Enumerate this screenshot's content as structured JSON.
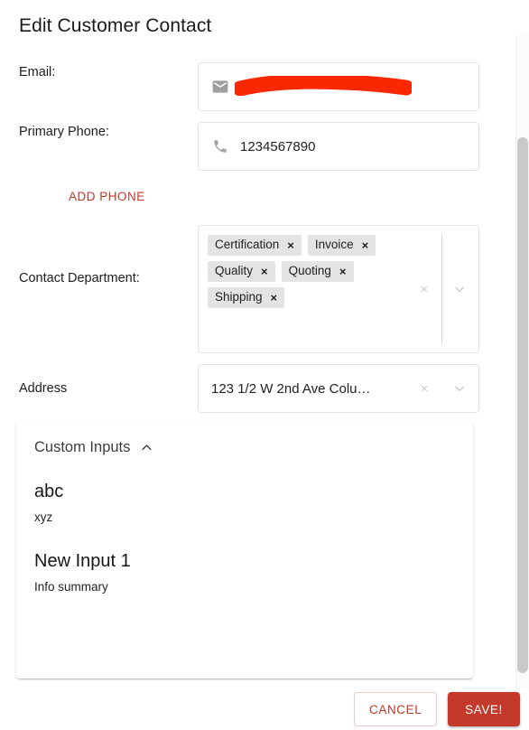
{
  "dialog": {
    "title": "Edit Customer Contact"
  },
  "fields": {
    "email": {
      "label": "Email:",
      "icon": "envelope-icon",
      "value": "",
      "redacted": true
    },
    "phone": {
      "label": "Primary Phone:",
      "icon": "phone-icon",
      "value": "1234567890"
    },
    "add_phone_label": "ADD PHONE",
    "contact_department": {
      "label": "Contact Department:",
      "chips": [
        {
          "label": "Certification",
          "remove": "×"
        },
        {
          "label": "Invoice",
          "remove": "×"
        },
        {
          "label": "Quality",
          "remove": "×"
        },
        {
          "label": "Quoting",
          "remove": "×"
        },
        {
          "label": "Shipping",
          "remove": "×"
        }
      ],
      "clear": "×",
      "chevron": "chevron-down-icon"
    },
    "address": {
      "label": "Address",
      "value": "123 1/2 W 2nd Ave Colu…",
      "clear": "×",
      "chevron": "chevron-down-icon"
    }
  },
  "custom_inputs": {
    "title": "Custom Inputs",
    "expanded": true,
    "caret": "chevron-up-icon",
    "items": [
      {
        "name": "abc",
        "description": "xyz"
      },
      {
        "name": "New Input 1",
        "description": "Info summary"
      }
    ]
  },
  "footer": {
    "cancel_label": "CANCEL",
    "save_label": "SAVE!"
  },
  "colors": {
    "accent_red": "#c4392a",
    "link_red": "#c0392b",
    "redaction_red": "#fa2800",
    "chip_bg": "#e4e4e4",
    "border": "#e2e2e2"
  }
}
